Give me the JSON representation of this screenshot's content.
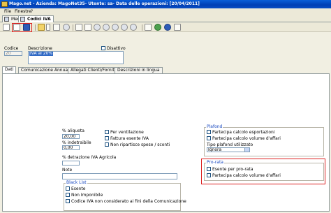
{
  "window": {
    "title": "Mago.net - Azienda: MagoNet35- Utente: sa- Data delle operazioni: [20/04/2011]"
  },
  "menu": {
    "items": [
      "File",
      "Finestre",
      "?"
    ]
  },
  "tabs": [
    "Menu",
    "Codici IVA"
  ],
  "toolbar": {
    "buttons": [
      "new-document",
      "edit",
      "save",
      "run",
      "print",
      "arrange",
      "preview",
      "tools",
      "first",
      "previous",
      "next",
      "last",
      "search",
      "undo",
      "refresh",
      "help",
      "close"
    ]
  },
  "form": {
    "codice_label": "Codice",
    "codice_value": "20",
    "descrizione_label": "Descrizione",
    "descrizione_value": "IVA al 20%",
    "disattivo_label": "Disattivo"
  },
  "subtabs": [
    "Dati",
    "Comunicazione Annuale",
    "Allegati Clienti/Fornitori",
    "Descrizioni in lingua"
  ],
  "dati": {
    "aliquota_label": "% aliquota",
    "aliquota_value": "20,00",
    "indetraibile_label": "% indetraibile",
    "indetraibile_value": "0,00",
    "detrazione_label": "% detrazione IVA Agricola",
    "detrazione_value": "",
    "note_label": "Note",
    "note_value": "",
    "checks": [
      "Per ventilazione",
      "Fattura esente IVA",
      "Non ripartisce spese / sconti"
    ]
  },
  "black_list": {
    "title": "Black List",
    "items": [
      "Esente",
      "Non Imponibile",
      "Codice IVA non considerato ai fini della Comunicazione"
    ]
  },
  "plafond": {
    "title": "Plafond",
    "checks": [
      "Partecipa calcolo esportazioni",
      "Partecipa calcolo volume d'affari"
    ],
    "tipo_label": "Tipo plafond utilizzato",
    "tipo_value": "Ignora"
  },
  "pro_rata": {
    "title": "Pro-rata",
    "items": [
      "Esente per pro-rata",
      "Partecipa calcolo volume d'affari"
    ]
  },
  "colors": {
    "titlebar": "#0a4ec4",
    "highlight_box": "#dd1f1f",
    "selection": "#316ac5",
    "group_title": "#1848c0"
  }
}
